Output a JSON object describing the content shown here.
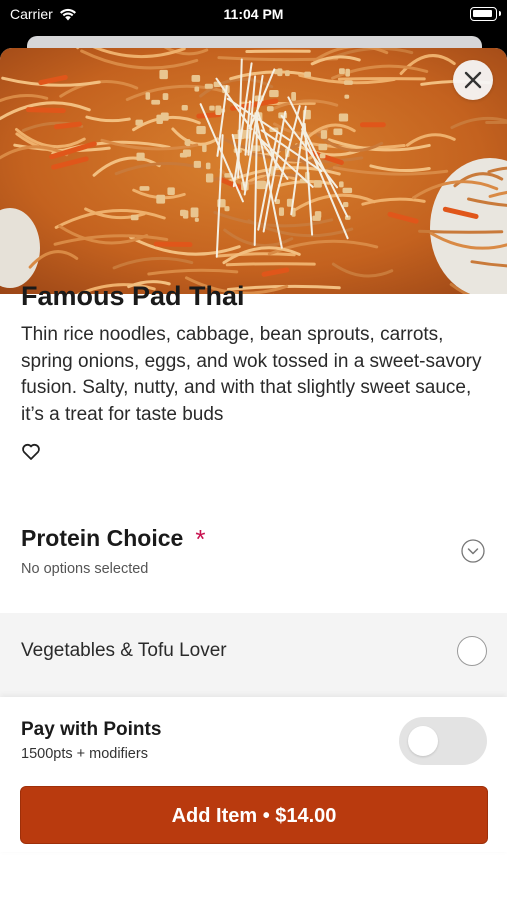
{
  "status_bar": {
    "carrier": "Carrier",
    "time": "11:04 PM"
  },
  "item": {
    "title": "Famous Pad Thai",
    "description": "Thin rice noodles, cabbage, bean sprouts, carrots, spring onions, eggs, and wok tossed in a sweet-savory fusion. Salty, nutty, and with that slightly sweet sauce, it’s a treat for taste buds",
    "image_icon": "pad-thai-photo",
    "favorite_icon": "heart-outline-icon"
  },
  "protein": {
    "title": "Protein Choice",
    "required_mark": "*",
    "subtitle": "No options selected",
    "expand_icon": "chevron-down-circle-icon"
  },
  "options": [
    {
      "label": "Vegetables & Tofu Lover",
      "selected": false
    }
  ],
  "points": {
    "title": "Pay with Points",
    "subtitle": "1500pts + modifiers",
    "toggle_on": false
  },
  "cta": {
    "label": "Add Item • $14.00"
  },
  "colors": {
    "accent": "#b93a0e",
    "required": "#c8104e"
  }
}
